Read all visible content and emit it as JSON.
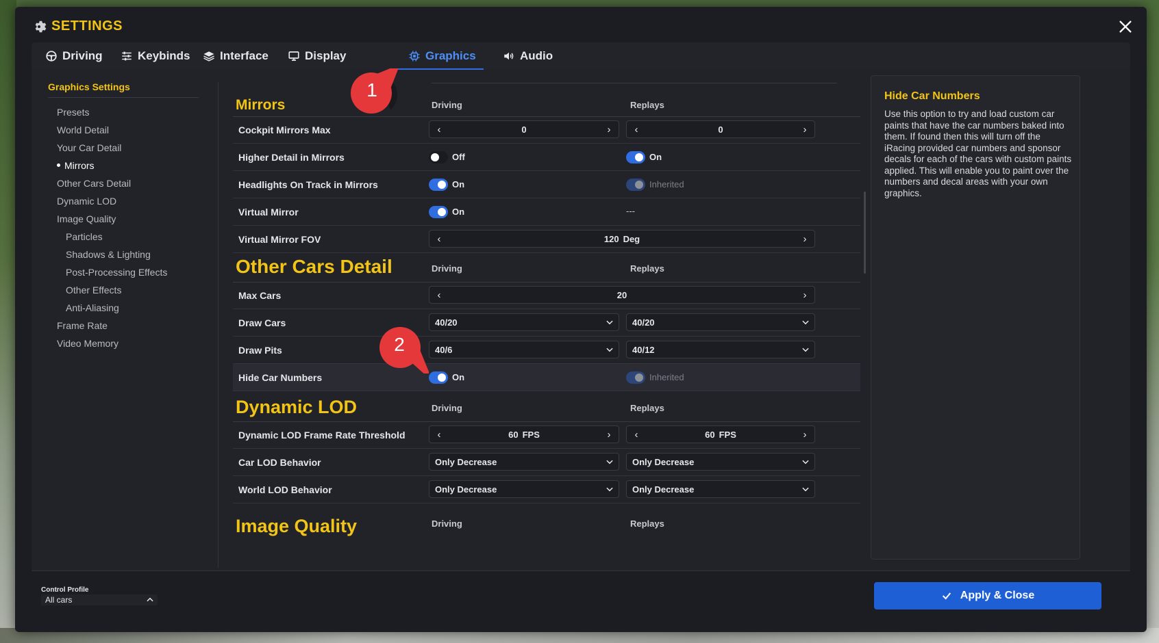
{
  "window": {
    "title": "SETTINGS"
  },
  "tabs": [
    {
      "label": "Driving",
      "icon": "steering-wheel-icon"
    },
    {
      "label": "Keybinds",
      "icon": "sliders-icon"
    },
    {
      "label": "Interface",
      "icon": "layers-icon"
    },
    {
      "label": "Display",
      "icon": "monitor-icon"
    },
    {
      "label": "Graphics",
      "icon": "chip-icon",
      "active": true
    },
    {
      "label": "Audio",
      "icon": "speaker-icon"
    }
  ],
  "sidebar": {
    "title": "Graphics Settings",
    "items": [
      {
        "label": "Presets"
      },
      {
        "label": "World Detail"
      },
      {
        "label": "Your Car Detail"
      },
      {
        "label": "Mirrors",
        "active": true
      },
      {
        "label": "Other Cars Detail"
      },
      {
        "label": "Dynamic LOD"
      },
      {
        "label": "Image Quality"
      },
      {
        "label": "Particles"
      },
      {
        "label": "Shadows & Lighting"
      },
      {
        "label": "Post-Processing Effects"
      },
      {
        "label": "Other Effects"
      },
      {
        "label": "Anti-Aliasing"
      },
      {
        "label": "Frame Rate"
      },
      {
        "label": "Video Memory"
      }
    ]
  },
  "columns": {
    "driving": "Driving",
    "replays": "Replays"
  },
  "sections": {
    "mirrors": {
      "title": "Mirrors",
      "rows": {
        "cockpit_mirrors_max": {
          "label": "Cockpit Mirrors Max",
          "driving": "0",
          "replays": "0"
        },
        "higher_detail": {
          "label": "Higher Detail in Mirrors",
          "driving": "Off",
          "replays": "On"
        },
        "headlights": {
          "label": "Headlights On Track in Mirrors",
          "driving": "On",
          "replays": "Inherited"
        },
        "virtual_mirror": {
          "label": "Virtual Mirror",
          "driving": "On",
          "replays": "---"
        },
        "virtual_mirror_fov": {
          "label": "Virtual Mirror FOV",
          "value": "120",
          "unit": "Deg"
        }
      }
    },
    "other_cars": {
      "title": "Other Cars Detail",
      "rows": {
        "max_cars": {
          "label": "Max Cars",
          "value": "20"
        },
        "draw_cars": {
          "label": "Draw Cars",
          "driving": "40/20",
          "replays": "40/20"
        },
        "draw_pits": {
          "label": "Draw Pits",
          "driving": "40/6",
          "replays": "40/12"
        },
        "hide_car_numbers": {
          "label": "Hide Car Numbers",
          "driving": "On",
          "replays": "Inherited"
        }
      }
    },
    "dynamic_lod": {
      "title": "Dynamic LOD",
      "rows": {
        "frame_rate_threshold": {
          "label": "Dynamic LOD Frame Rate Threshold",
          "driving": "60",
          "replays": "60",
          "unit": "FPS"
        },
        "car_lod": {
          "label": "Car LOD Behavior",
          "driving": "Only Decrease",
          "replays": "Only Decrease"
        },
        "world_lod": {
          "label": "World LOD Behavior",
          "driving": "Only Decrease",
          "replays": "Only Decrease"
        }
      }
    },
    "image_quality": {
      "title": "Image Quality"
    }
  },
  "help": {
    "title": "Hide Car Numbers",
    "body": "Use this option to try and load custom car paints that have the car numbers baked into them. If found then this will turn off the iRacing provided car numbers and sponsor decals for each of the cars with custom paints applied. This will enable you to paint over the numbers and decal areas with your own graphics."
  },
  "footer": {
    "control_profile_label": "Control Profile",
    "control_profile_value": "All cars",
    "apply_label": "Apply & Close"
  },
  "markers": {
    "one": "1",
    "two": "2"
  },
  "colors": {
    "accent_yellow": "#f2c418",
    "accent_blue": "#2f6de1",
    "panel": "#222329",
    "marker_red": "#e5383b"
  }
}
